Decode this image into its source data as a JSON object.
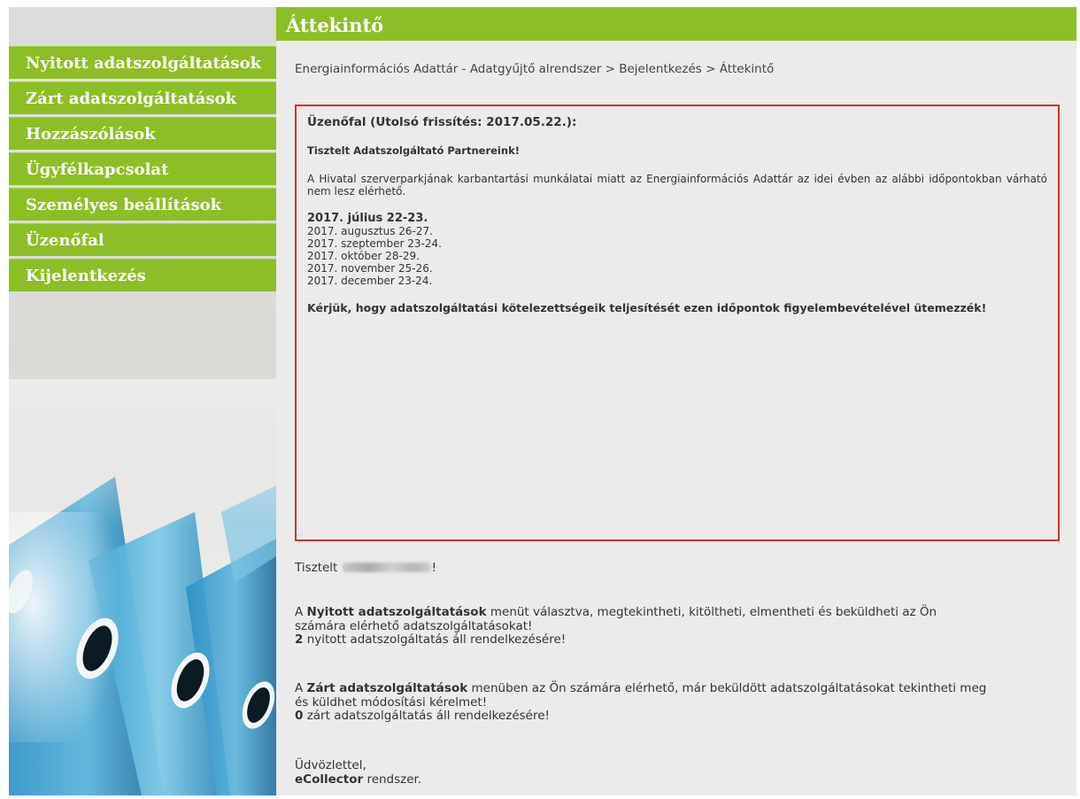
{
  "sidebar": {
    "items": [
      {
        "label": "Nyitott adatszolgáltatások"
      },
      {
        "label": "Zárt adatszolgáltatások"
      },
      {
        "label": "Hozzászólások"
      },
      {
        "label": "Ügyfélkapcsolat"
      },
      {
        "label": "Személyes beállítások"
      },
      {
        "label": "Üzenőfal"
      },
      {
        "label": "Kijelentkezés"
      }
    ]
  },
  "header": {
    "title": "Áttekintő"
  },
  "breadcrumb": "Energiainformációs Adattár - Adatgyűjtő alrendszer > Bejelentkezés > Áttekintő",
  "message_board": {
    "title": "Üzenőfal (Utolsó frissítés: 2017.05.22.):",
    "greeting": "Tisztelt Adatszolgáltató Partnereink!",
    "paragraph": "A Hivatal szerverparkjának karbantartási munkálatai miatt az Energiainformációs Adattár az idei évben az alábbi időpontokban várható nem lesz elérhető.",
    "dates": [
      "2017. július 22-23.",
      "2017. augusztus 26-27.",
      "2017. szeptember 23-24.",
      "2017. október 28-29.",
      "2017. november 25-26.",
      "2017. december 23-24."
    ],
    "request": "Kérjük, hogy adatszolgáltatási kötelezettségeik teljesítését ezen időpontok figyelembevételével ütemezzék!"
  },
  "welcome": {
    "salutation_prefix": "Tisztelt",
    "salutation_suffix": "!",
    "open_prefix": "A",
    "open_link": "Nyitott adatszolgáltatások",
    "open_text_1": "menüt választva, megtekintheti, kitöltheti, elmentheti és beküldheti az Ön",
    "open_text_2": "számára elérhető adatszolgáltatásokat!",
    "open_count": "2",
    "open_count_text": "nyitott adatszolgáltatás áll rendelkezésére!",
    "closed_prefix": "A",
    "closed_link": "Zárt adatszolgáltatások",
    "closed_text_1": "menüben az Ön számára elérhető, már beküldött adatszolgáltatásokat tekintheti meg",
    "closed_text_2": "és küldhet módosítási kérelmet!",
    "closed_count": "0",
    "closed_count_text": "zárt adatszolgáltatás áll rendelkezésére!",
    "signoff": "Üdvözlettel,",
    "system_name": "eCollector",
    "system_suffix": "rendszer."
  },
  "colors": {
    "accent": "#8cbf26",
    "alert_border": "#dd2b2b",
    "panel": "#ebebeb"
  }
}
